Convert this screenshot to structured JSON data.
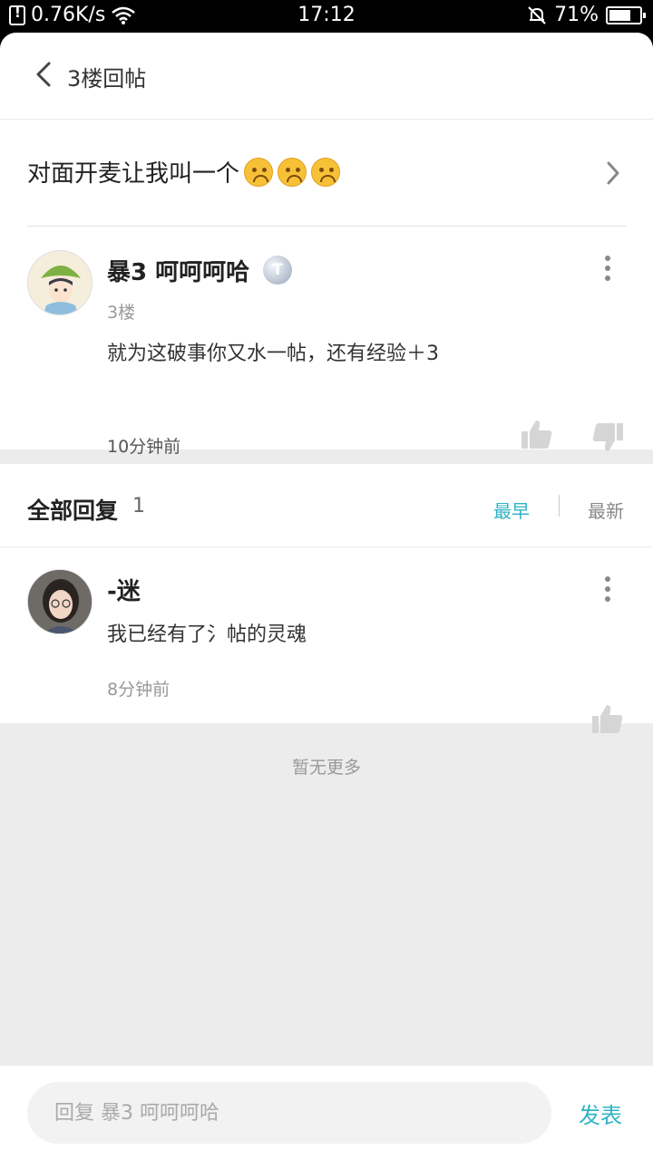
{
  "status_bar": {
    "speed": "0.76K/s",
    "time": "17:12",
    "battery": "71%",
    "battery_level": 0.71
  },
  "header": {
    "title": "3楼回帖"
  },
  "topic": {
    "title": "对面开麦让我叫一个"
  },
  "post": {
    "username": "暴3 呵呵呵哈",
    "level_badge": "T",
    "floor": "3楼",
    "content": "就为这破事你又水一帖，还有经验＋3",
    "time": "10分钟前"
  },
  "replies_header": {
    "title": "全部回复",
    "count": "1",
    "sort_earliest": "最早",
    "sort_newest": "最新"
  },
  "replies": [
    {
      "username": "-迷",
      "content": "我已经有了氵帖的灵魂",
      "time": "8分钟前"
    }
  ],
  "footer_note": "暂无更多",
  "composer": {
    "placeholder": "回复 暴3 呵呵呵哈",
    "send_label": "发表"
  },
  "colors": {
    "accent": "#2fb3c5",
    "background": "#ececec"
  }
}
